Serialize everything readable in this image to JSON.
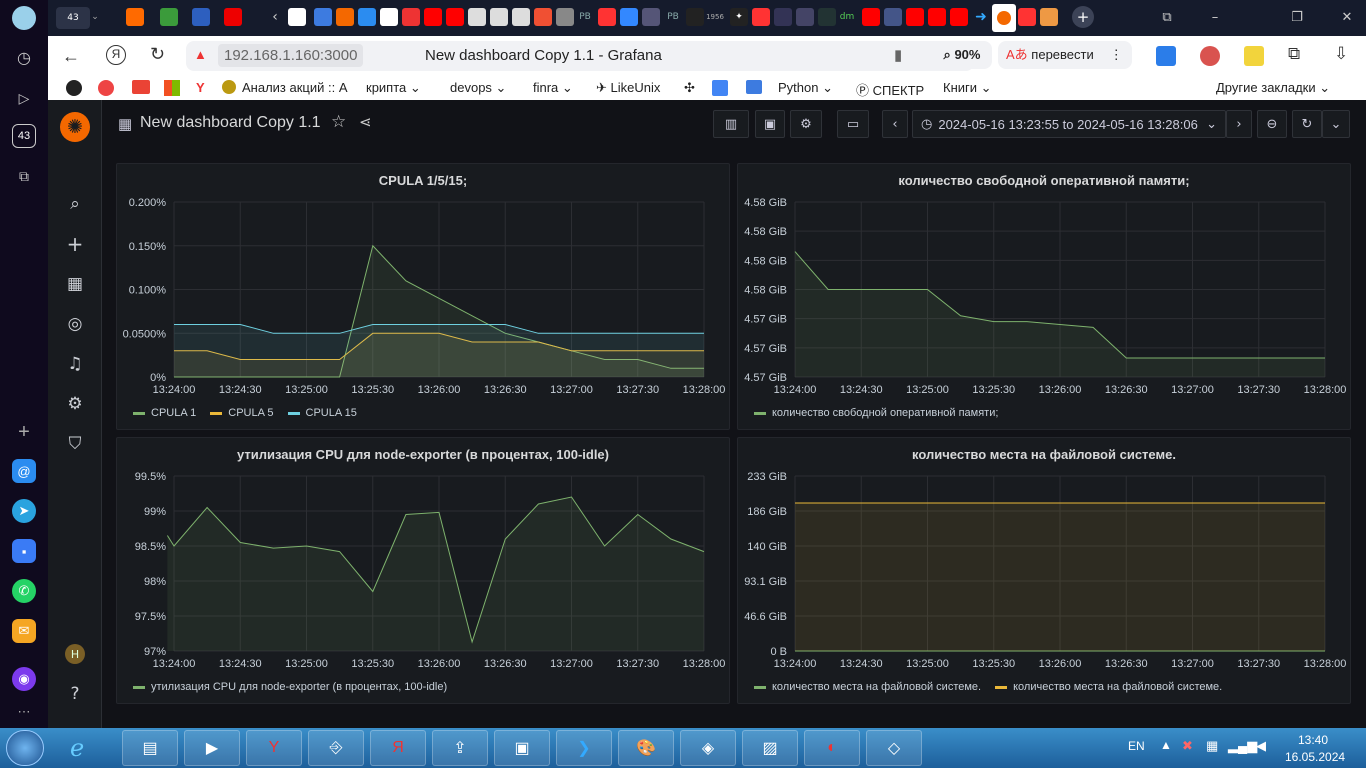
{
  "browser": {
    "tab_count": "43",
    "url": "192.168.1.160:3000",
    "page_title": "New dashboard Copy 1.1 - Grafana",
    "zoom": "90%",
    "translate_label": "перевести",
    "bookmarks": [
      "Анализ акций :: А",
      "крипта",
      "devops",
      "finra",
      "LikeUnix",
      "Python",
      "СПЕКТР",
      "Книги"
    ],
    "other_bookmarks": "Другие закладки",
    "tab_badge_1956": "1956",
    "tab_rb": "РВ",
    "tab_dm": "dm"
  },
  "grafana": {
    "dashboard_title": "New dashboard Copy 1.1",
    "time_range": "2024-05-16 13:23:55 to 2024-05-16 13:28:06",
    "avatar": "H"
  },
  "panels": {
    "cpula": {
      "title": "CPULA 1/5/15;",
      "legend": [
        "CPULA 1",
        "CPULA 5",
        "CPULA 15"
      ]
    },
    "mem": {
      "title": "количество свободной оперативной памяти;",
      "legend": [
        "количество свободной оперативной памяти;"
      ]
    },
    "cpu": {
      "title": "утилизация CPU для node-exporter (в процентах, 100-idle)",
      "legend": [
        "утилизация CPU для node-exporter (в процентах, 100-idle)"
      ]
    },
    "fs": {
      "title": "количество места на файловой системе.",
      "legend": [
        "количество места на файловой системе.",
        "количество места на файловой системе."
      ]
    }
  },
  "chart_data": [
    {
      "type": "line",
      "title": "CPULA 1/5/15;",
      "x": [
        "13:24:00",
        "13:24:15",
        "13:24:30",
        "13:24:45",
        "13:25:00",
        "13:25:15",
        "13:25:30",
        "13:25:45",
        "13:26:00",
        "13:26:15",
        "13:26:30",
        "13:26:45",
        "13:27:00",
        "13:27:15",
        "13:27:30",
        "13:27:45",
        "13:28:00"
      ],
      "xticks": [
        "13:24:00",
        "13:24:30",
        "13:25:00",
        "13:25:30",
        "13:26:00",
        "13:26:30",
        "13:27:00",
        "13:27:30",
        "13:28:00"
      ],
      "yticks": [
        "0%",
        "0.0500%",
        "0.100%",
        "0.150%",
        "0.200%"
      ],
      "ylim": [
        0,
        0.2
      ],
      "series": [
        {
          "name": "CPULA 1",
          "color": "#7eb26d",
          "values": [
            0,
            0,
            0,
            0,
            0,
            0,
            0.15,
            0.11,
            0.09,
            0.07,
            0.05,
            0.04,
            0.03,
            0.02,
            0.02,
            0.01,
            0.01
          ]
        },
        {
          "name": "CPULA 5",
          "color": "#eab839",
          "values": [
            0.03,
            0.03,
            0.02,
            0.02,
            0.02,
            0.02,
            0.05,
            0.05,
            0.05,
            0.04,
            0.04,
            0.04,
            0.03,
            0.03,
            0.03,
            0.03,
            0.03
          ]
        },
        {
          "name": "CPULA 15",
          "color": "#6ed0e0",
          "values": [
            0.06,
            0.06,
            0.06,
            0.05,
            0.05,
            0.05,
            0.06,
            0.06,
            0.06,
            0.06,
            0.06,
            0.05,
            0.05,
            0.05,
            0.05,
            0.05,
            0.05
          ]
        }
      ]
    },
    {
      "type": "line",
      "title": "количество свободной оперативной памяти;",
      "x": [
        "13:24:00",
        "13:24:15",
        "13:24:30",
        "13:24:45",
        "13:25:00",
        "13:25:15",
        "13:25:30",
        "13:25:45",
        "13:26:00",
        "13:26:15",
        "13:26:30",
        "13:26:45",
        "13:27:00",
        "13:27:15",
        "13:27:30",
        "13:27:45",
        "13:28:00"
      ],
      "xticks": [
        "13:24:00",
        "13:24:30",
        "13:25:00",
        "13:25:30",
        "13:26:00",
        "13:26:30",
        "13:27:00",
        "13:27:30",
        "13:28:00"
      ],
      "yticks": [
        "4.57 GiB",
        "4.57 GiB",
        "4.57 GiB",
        "4.58 GiB",
        "4.58 GiB",
        "4.58 GiB",
        "4.58 GiB"
      ],
      "ylim": [
        0,
        6
      ],
      "series": [
        {
          "name": "количество свободной оперативной памяти;",
          "color": "#7eb26d",
          "values": [
            4.3,
            3.0,
            3.0,
            3.0,
            3.0,
            2.1,
            1.9,
            1.9,
            1.8,
            1.7,
            0.65,
            0.65,
            0.65,
            0.65,
            0.65,
            0.65,
            0.65
          ]
        }
      ]
    },
    {
      "type": "line",
      "title": "утилизация CPU для node-exporter (в процентах, 100-idle)",
      "x": [
        "13:23:57",
        "13:24:00",
        "13:24:15",
        "13:24:30",
        "13:24:45",
        "13:25:00",
        "13:25:15",
        "13:25:30",
        "13:25:45",
        "13:26:00",
        "13:26:15",
        "13:26:30",
        "13:26:45",
        "13:27:00",
        "13:27:15",
        "13:27:30",
        "13:27:45",
        "13:28:00"
      ],
      "xticks": [
        "13:24:00",
        "13:24:30",
        "13:25:00",
        "13:25:30",
        "13:26:00",
        "13:26:30",
        "13:27:00",
        "13:27:30",
        "13:28:00"
      ],
      "yticks": [
        "97%",
        "97.5%",
        "98%",
        "98.5%",
        "99%",
        "99.5%"
      ],
      "ylim": [
        97,
        99.5
      ],
      "series": [
        {
          "name": "утилизация CPU для node-exporter (в процентах, 100-idle)",
          "color": "#7eb26d",
          "values": [
            98.65,
            98.5,
            99.05,
            98.55,
            98.47,
            98.5,
            98.42,
            97.85,
            98.95,
            98.98,
            97.13,
            98.6,
            99.1,
            99.2,
            98.5,
            98.95,
            98.6,
            98.42
          ]
        }
      ]
    },
    {
      "type": "line",
      "title": "количество места на файловой системе.",
      "x": [
        "13:24:00",
        "13:28:00"
      ],
      "xticks": [
        "13:24:00",
        "13:24:30",
        "13:25:00",
        "13:25:30",
        "13:26:00",
        "13:26:30",
        "13:27:00",
        "13:27:30",
        "13:28:00"
      ],
      "yticks": [
        "0 B",
        "46.6 GiB",
        "93.1 GiB",
        "140 GiB",
        "186 GiB",
        "233 GiB"
      ],
      "ylim": [
        0,
        233
      ],
      "series": [
        {
          "name": "количество места на файловой системе.",
          "color": "#7eb26d",
          "values": [
            0,
            0
          ]
        },
        {
          "name": "количество места на файловой системе.",
          "color": "#eab839",
          "values": [
            197,
            197
          ]
        }
      ]
    }
  ],
  "taskbar": {
    "lang": "EN",
    "time": "13:40",
    "date": "16.05.2024"
  }
}
